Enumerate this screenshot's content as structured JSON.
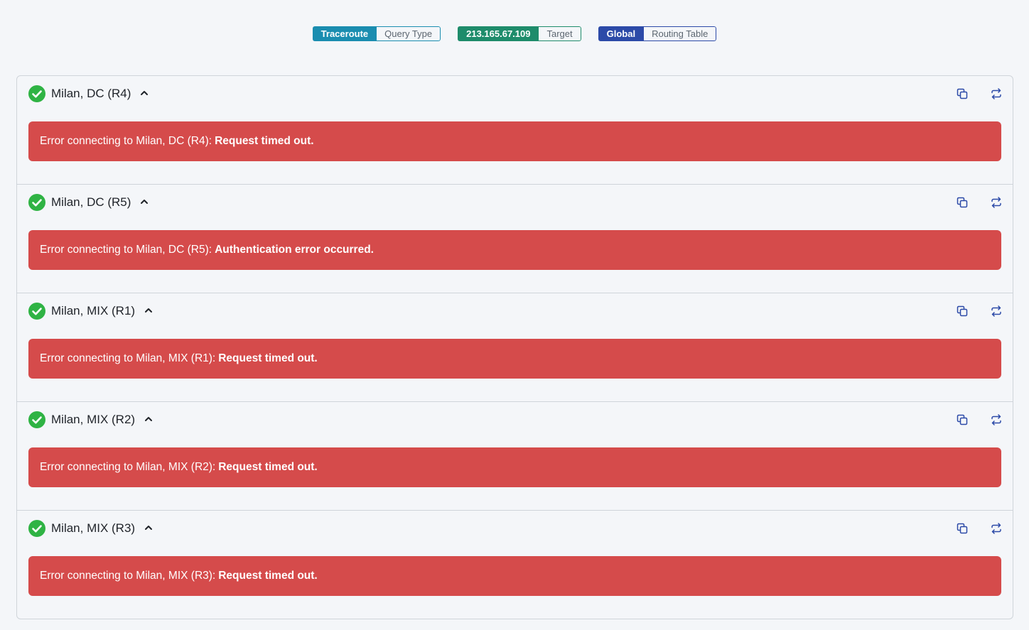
{
  "query_tags": [
    {
      "value": "Traceroute",
      "label": "Query Type",
      "color": "#1a8db0"
    },
    {
      "value": "213.165.67.109",
      "label": "Target",
      "color": "#1e8c6b"
    },
    {
      "value": "Global",
      "label": "Routing Table",
      "color": "#2c4aa8"
    }
  ],
  "results": [
    {
      "device": "Milan, DC (R4)",
      "error_prefix": "Error connecting to Milan, DC (R4):",
      "error_detail": "Request timed out."
    },
    {
      "device": "Milan, DC (R5)",
      "error_prefix": "Error connecting to Milan, DC (R5):",
      "error_detail": "Authentication error occurred."
    },
    {
      "device": "Milan, MIX (R1)",
      "error_prefix": "Error connecting to Milan, MIX (R1):",
      "error_detail": "Request timed out."
    },
    {
      "device": "Milan, MIX (R2)",
      "error_prefix": "Error connecting to Milan, MIX (R2):",
      "error_detail": "Request timed out."
    },
    {
      "device": "Milan, MIX (R3)",
      "error_prefix": "Error connecting to Milan, MIX (R3):",
      "error_detail": "Request timed out."
    }
  ],
  "icons": {
    "status": "check-circle-icon",
    "toggle": "chevron-up-icon",
    "copy": "copy-icon",
    "requery": "refresh-icon"
  },
  "colors": {
    "success": "#2fb344",
    "error_bg": "#d54b4b",
    "action_icon": "#2c4aa8"
  }
}
